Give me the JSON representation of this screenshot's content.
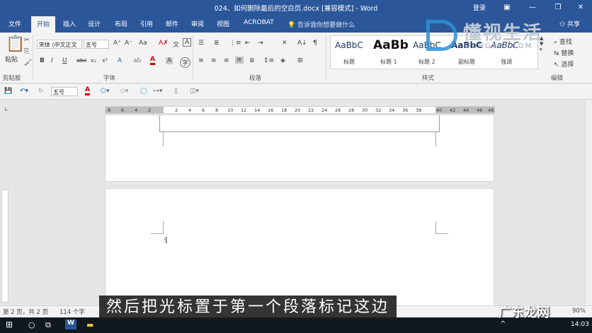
{
  "window": {
    "title": "024、如何删除最后的空白页.docx [兼容模式] - Word",
    "login": "登录",
    "share": "共享"
  },
  "ribbon_tabs": [
    "文件",
    "开始",
    "插入",
    "设计",
    "布局",
    "引用",
    "邮件",
    "审阅",
    "视图",
    "ACROBAT"
  ],
  "tell_me": "告诉我你想要做什么",
  "font": {
    "name": "宋体 (中文正文",
    "size": "五号",
    "paste_label": "粘贴",
    "clipboard_label": "剪贴板",
    "font_group_label": "字体",
    "paragraph_group_label": "段落",
    "styles_group_label": "样式",
    "editing_group_label": "编辑"
  },
  "styles": [
    {
      "sample": "AaBbC",
      "name": "标题"
    },
    {
      "sample": "AaBb",
      "name": "标题 1"
    },
    {
      "sample": "AaBbC",
      "name": "标题 2"
    },
    {
      "sample": "AaBbC",
      "name": "副标题"
    },
    {
      "sample": "AaBbC",
      "name": "强调"
    }
  ],
  "editing": {
    "find": "查找",
    "replace": "替换",
    "select": "选择"
  },
  "qat": {
    "size": "五号"
  },
  "ruler_numbers": [
    "8",
    "6",
    "4",
    "2",
    "2",
    "4",
    "6",
    "8",
    "10",
    "12",
    "14",
    "16",
    "18",
    "20",
    "22",
    "24",
    "26",
    "28",
    "30",
    "32",
    "34",
    "36",
    "38",
    "40",
    "42",
    "44",
    "46",
    "48"
  ],
  "status": {
    "page": "第 2 页，共 2 页",
    "words": "114 个字",
    "zoom": "90%"
  },
  "taskbar": {
    "time": "14:03"
  },
  "subtitle": "然后把光标置于第一个段落标记这边",
  "watermark": {
    "logo_text": "懂视生活",
    "logo_sub": "DONGSHI.COM",
    "site": "广东龙网"
  }
}
